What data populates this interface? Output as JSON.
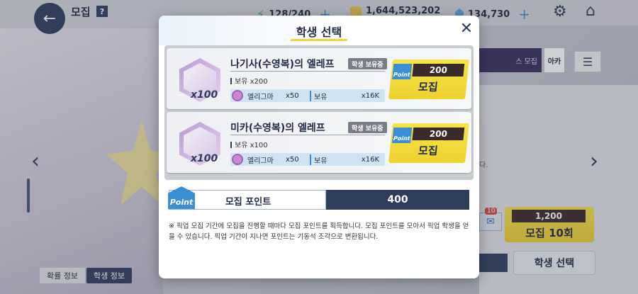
{
  "header": {
    "back_icon": "arrow-left-icon",
    "title": "모집",
    "help": "?",
    "ap": "128/240",
    "credits": "1,644,523,202",
    "gems": "134,730",
    "plus": "+"
  },
  "background": {
    "badge_text": "스 모집",
    "tab_text": "아카",
    "notice_fragment": "다.",
    "recruit10_cost": "1,200",
    "recruit10_label": "모집 10회",
    "mail_badge": "10",
    "select_student_label": "학생 선택",
    "tab_rate_info": "확률 정보",
    "tab_student_info": "학생 정보"
  },
  "modal": {
    "title": "학생 선택",
    "items": [
      {
        "name": "나기사(수영복)의 엘레프",
        "badge": "학생 보유중",
        "owned": "보유 x200",
        "count": "x100",
        "material": "엘리그마",
        "material_need": "x50",
        "owned_label": "보유",
        "material_owned": "x16K",
        "point_tag": "Point",
        "cost": "200",
        "button": "모집"
      },
      {
        "name": "미카(수영복)의 엘레프",
        "badge": "학생 보유중",
        "owned": "보유 x100",
        "count": "x100",
        "material": "엘리그마",
        "material_need": "x50",
        "owned_label": "보유",
        "material_owned": "x16K",
        "point_tag": "Point",
        "cost": "200",
        "button": "모집"
      }
    ],
    "points": {
      "icon_text": "Point",
      "label": "모집 포인트",
      "value": "400"
    },
    "notice": "※ 픽업 모집 기간에 모집을 진행할 때마다 모집 포인트를 획득합니다. 모집 포인트를 모아서 픽업 학생을 얻을 수 있습니다. 픽업 기간이 지나면 포인트는 기동석 조각으로 변환됩니다."
  }
}
